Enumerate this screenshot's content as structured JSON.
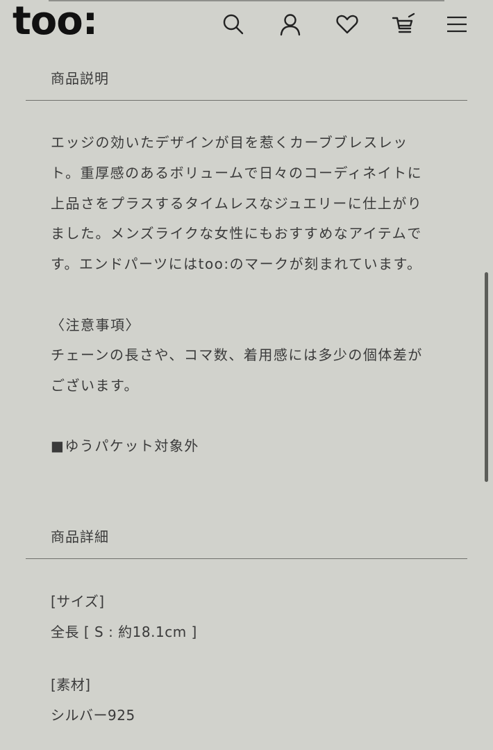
{
  "header": {
    "logo": "too:",
    "icons": [
      "search-icon",
      "user-icon",
      "heart-icon",
      "cart-icon",
      "menu-icon"
    ]
  },
  "description": {
    "heading": "商品説明",
    "lines": [
      "エッジの効いたデザインが目を惹くカーブブレスレッ",
      "ト。重厚感のあるボリュームで日々のコーディネイトに",
      "上品さをプラスするタイムレスなジュエリーに仕上がり",
      "ました。メンズライクな女性にもおすすめなアイテムで",
      "す。エンドパーツにはtoo:のマークが刻まれています。"
    ],
    "notice_title": "〈注意事項〉",
    "notice_lines": [
      "チェーンの長さや、コマ数、着用感には多少の個体差が",
      "ございます。"
    ],
    "shipping_note": "■ゆうパケット対象外"
  },
  "details": {
    "heading": "商品詳細",
    "size_label": "[サイズ]",
    "size_value": "全長 [ S : 約18.1cm ]",
    "material_label": "[素材]",
    "material_value": "シルバー925"
  }
}
